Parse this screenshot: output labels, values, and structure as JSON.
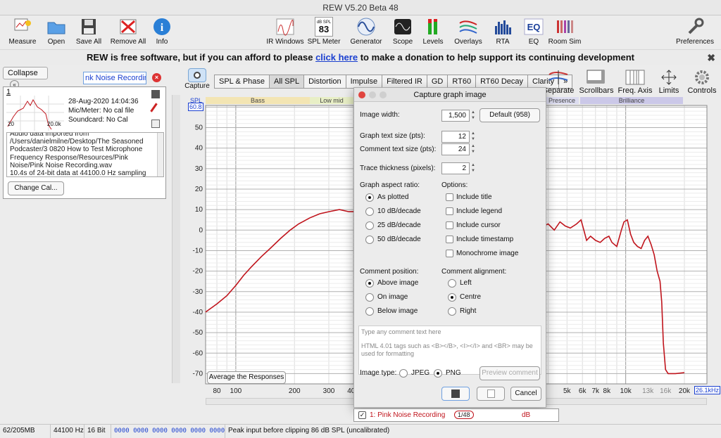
{
  "window_title": "REW V5.20 Beta 48",
  "toolbar_left": [
    {
      "label": "Measure",
      "icon": "microphone-icon"
    },
    {
      "label": "Open",
      "icon": "folder-icon"
    },
    {
      "label": "Save All",
      "icon": "floppy-icon"
    },
    {
      "label": "Remove All",
      "icon": "remove-icon"
    },
    {
      "label": "Info",
      "icon": "info-icon"
    }
  ],
  "toolbar_right": [
    {
      "label": "IR Windows",
      "icon": "ir-windows-icon"
    },
    {
      "label": "SPL Meter",
      "icon": "spl-meter-icon",
      "badge_top": "dB SPL",
      "badge_value": "83"
    },
    {
      "label": "Generator",
      "icon": "sine-wave-icon"
    },
    {
      "label": "Scope",
      "icon": "scope-icon"
    },
    {
      "label": "Levels",
      "icon": "levels-icon"
    },
    {
      "label": "Overlays",
      "icon": "overlays-icon"
    },
    {
      "label": "RTA",
      "icon": "rta-icon"
    },
    {
      "label": "EQ",
      "icon": "eq-icon"
    },
    {
      "label": "Room Sim",
      "icon": "room-sim-icon"
    }
  ],
  "preferences_label": "Preferences",
  "banner": {
    "before": "REW is free software, but if you can afford to please ",
    "link": "click here",
    "after": " to make a donation to help support its continuing development"
  },
  "left_panel": {
    "collapse_label": "Collapse",
    "measurement_name": "nk Noise Recording",
    "index": "1",
    "date": "28-Aug-2020 14:04:36",
    "mic_meter": "Mic/Meter: No cal file",
    "soundcard": "Soundcard: No Cal",
    "thumb_left": "20",
    "thumb_right": "20.0k",
    "notes": [
      "Audio data imported from",
      "/Users/danielmilne/Desktop/The Seasoned",
      "Podcaster/3 0820 How to Test Microphone",
      "Frequency Response/Resources/Pink",
      "Noise/Pink Noise Recording.wav",
      "10.4s of 24-bit data at 44100.0 Hz sampling"
    ],
    "change_cal_label": "Change Cal..."
  },
  "capture_label": "Capture",
  "graph_tabs": [
    "SPL & Phase",
    "All SPL",
    "Distortion",
    "Impulse",
    "Filtered IR",
    "GD",
    "RT60",
    "RT60 Decay",
    "Clarity",
    "»"
  ],
  "active_tab": "All SPL",
  "right_tools": [
    "Separate",
    "Scrollbars",
    "Freq. Axis",
    "Limits",
    "Controls"
  ],
  "graph": {
    "spl_label": "SPL",
    "y_top_box": "60.8",
    "y_ticks": [
      "50",
      "40",
      "30",
      "20",
      "10",
      "0",
      "-10",
      "-20",
      "-30",
      "-40",
      "-50",
      "-60",
      "-70"
    ],
    "x_ticks": [
      "80",
      "100",
      "200",
      "300",
      "400",
      "5k",
      "6k",
      "7k",
      "8k",
      "10k",
      "13k",
      "16k",
      "20k"
    ],
    "x_end_box": "26.1kHz",
    "bands": [
      "Bass",
      "Low mid",
      "Presence",
      "Brilliance"
    ],
    "average_button": "Average the Responses",
    "trace_color": "#c0141c"
  },
  "dialog": {
    "title": "Capture graph image",
    "image_width_label": "Image width:",
    "image_width_value": "1,500",
    "default_button": "Default (958)",
    "graph_text_label": "Graph text size (pts):",
    "graph_text_value": "12",
    "comment_text_label": "Comment text size (pts):",
    "comment_text_value": "24",
    "trace_thickness_label": "Trace thickness (pixels):",
    "trace_thickness_value": "2",
    "aspect_heading": "Graph aspect ratio:",
    "aspect_options": [
      "As plotted",
      "10 dB/decade",
      "25 dB/decade",
      "50 dB/decade"
    ],
    "aspect_selected": 0,
    "options_heading": "Options:",
    "options": [
      "Include title",
      "Include legend",
      "Include cursor",
      "Include timestamp",
      "Monochrome image"
    ],
    "comment_pos_heading": "Comment position:",
    "comment_pos_options": [
      "Above image",
      "On image",
      "Below image"
    ],
    "comment_pos_selected": 0,
    "comment_align_heading": "Comment alignment:",
    "comment_align_options": [
      "Left",
      "Centre",
      "Right"
    ],
    "comment_align_selected": 1,
    "comment_placeholder": "Type any comment text here",
    "comment_hint": "HTML 4.01 tags such as <B></B>, <I></I> and <BR> may be used for formatting",
    "image_type_label": "Image type:",
    "image_types": [
      "JPEG",
      "PNG"
    ],
    "image_type_selected": 1,
    "preview_button": "Preview comment",
    "cancel_button": "Cancel"
  },
  "selector": {
    "label": "1: Pink Noise Recording",
    "value": "1/48",
    "unit": "dB"
  },
  "status": {
    "memory": "62/205MB",
    "rate": "44100 Hz",
    "bits": "16 Bit",
    "hex": "0000 0000  0000 0000  0000 0000",
    "message": "Peak input before clipping 86 dB SPL (uncalibrated)"
  }
}
